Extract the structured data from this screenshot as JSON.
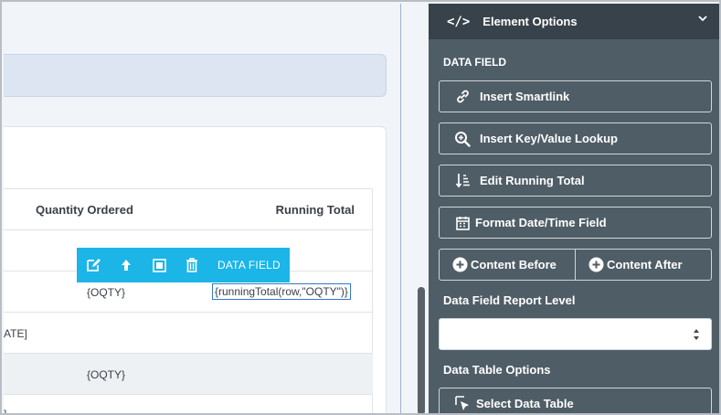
{
  "table": {
    "headers": {
      "quantity": "Quantity Ordered",
      "running": "Running Total"
    },
    "rows": [
      {
        "left": "",
        "qty": "{OQTY}",
        "running": "{runningTotal(row,\"OQTY\")}"
      },
      {
        "left": "ATE]",
        "qty": "",
        "running": ""
      },
      {
        "left": "",
        "qty": "{OQTY}",
        "running": ""
      },
      {
        "left": "]",
        "qty": "",
        "running": ""
      }
    ]
  },
  "toolbar": {
    "label": "DATA FIELD"
  },
  "panel": {
    "header_icon": "</>",
    "title": "Element Options",
    "section": "DATA FIELD",
    "buttons": {
      "smartlink": "Insert Smartlink",
      "lookup": "Insert Key/Value Lookup",
      "running_total": "Edit Running Total",
      "format_date": "Format Date/Time Field",
      "content_before": "Content Before",
      "content_after": "Content After",
      "select_table": "Select Data Table"
    },
    "report_level_label": "Data Field Report Level",
    "report_level_value": "",
    "table_options_label": "Data Table Options"
  },
  "colors": {
    "toolbar": "#1bb5e8",
    "panel": "#4f5d66",
    "panel_header": "#38424a",
    "selection": "#2f7bc7"
  }
}
